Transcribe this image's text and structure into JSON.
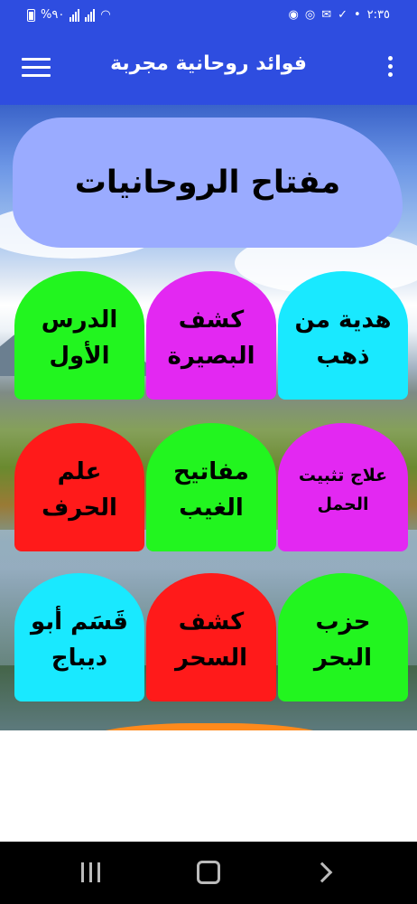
{
  "status_bar": {
    "battery_text": "%٩٠",
    "time": "٢:٣٥"
  },
  "app_bar": {
    "title": "فوائد روحانية مجربة",
    "menu_icon": "hamburger-menu-icon",
    "more_icon": "more-vert-icon"
  },
  "header_card": {
    "title": "مفتاح الروحانيات",
    "color": "#9aabff"
  },
  "tiles": [
    {
      "label": "هدية من\nذهب",
      "color": "#19e9ff"
    },
    {
      "label": "كشف\nالبصيرة",
      "color": "#e328f2"
    },
    {
      "label": "الدرس\nالأول",
      "color": "#22f51f"
    },
    {
      "label": "علاج تثبيت\nالحمل",
      "color": "#e328f2"
    },
    {
      "label": "مفاتيح\nالغيب",
      "color": "#22f51f"
    },
    {
      "label": "علم\nالحرف",
      "color": "#ff1a1a"
    },
    {
      "label": "حزب\nالبحر",
      "color": "#22f51f"
    },
    {
      "label": "كشف\nالسحر",
      "color": "#ff1a1a"
    },
    {
      "label": "قَسَم أبو\nديباج",
      "color": "#19e9ff"
    }
  ],
  "partial_tile_color": "#ff8a1c",
  "nav_bar": {
    "recents_icon": "recents-icon",
    "home_icon": "home-icon",
    "back_icon": "back-icon"
  }
}
